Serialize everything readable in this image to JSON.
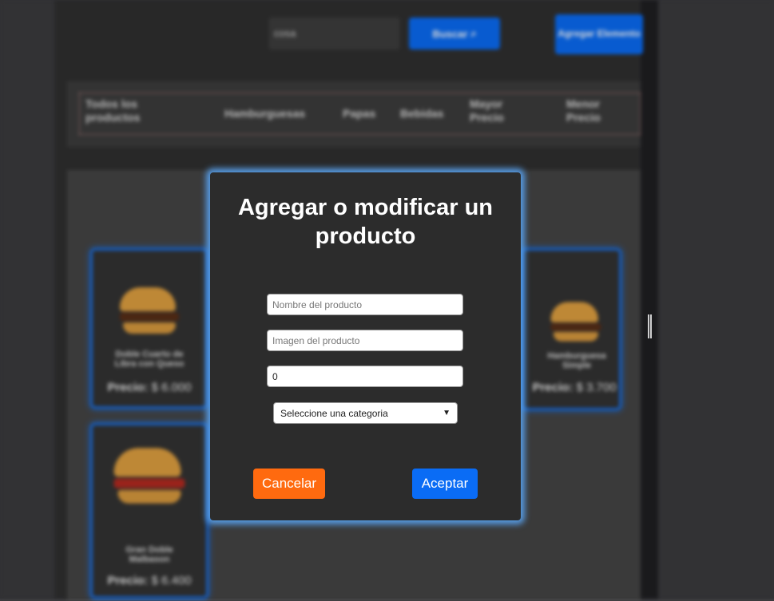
{
  "header": {
    "search_value": "cosa",
    "search_button": "Buscar",
    "add_button": "Agregar Elemento"
  },
  "nav": {
    "items": [
      "Todos los productos",
      "Hamburguesas",
      "Papas",
      "Bebidas",
      "Mayor Precio",
      "Menor Precio"
    ]
  },
  "products": [
    {
      "name": "Doble Cuarto de Libra con Queso",
      "price_label": "Precio:",
      "price": "$ 6.000"
    },
    {
      "name": "Hamburguesa Simple",
      "price_label": "Precio:",
      "price": "$ 3.700"
    },
    {
      "name": "Gran Doble Malbason",
      "price_label": "Precio:",
      "price": "$ 6.400"
    }
  ],
  "modal": {
    "title": "Agregar o modificar un producto",
    "name_placeholder": "Nombre del producto",
    "image_placeholder": "Imagen del producto",
    "price_value": "0",
    "category_select": "Seleccione una categoria",
    "cancel": "Cancelar",
    "accept": "Aceptar"
  },
  "colors": {
    "accent_blue": "#0a6cf5",
    "cancel_orange": "#ff6a0f",
    "modal_bg": "#2c2c2c",
    "glow": "#5aaaff"
  }
}
